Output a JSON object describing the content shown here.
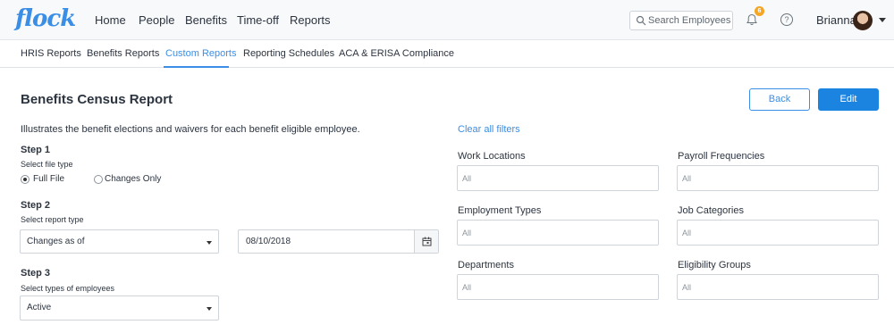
{
  "brand": {
    "logo_text": "flock",
    "accent": "#3a8ee6",
    "primary_button": "#1a84e0",
    "badge_color": "#f5a623"
  },
  "nav": {
    "items": [
      "Home",
      "People",
      "Benefits",
      "Time-off",
      "Reports"
    ]
  },
  "header": {
    "search_placeholder": "Search Employees",
    "notification_count": "6",
    "user_name": "Brianna",
    "icons": {
      "search": "search-icon",
      "bell": "bell-icon",
      "help": "help-icon",
      "menu": "chevron-down-icon"
    }
  },
  "subnav": {
    "tabs": [
      "HRIS Reports",
      "Benefits Reports",
      "Custom Reports",
      "Reporting Schedules",
      "ACA & ERISA Compliance"
    ],
    "active": "Custom Reports"
  },
  "report": {
    "title": "Benefits Census Report",
    "back_label": "Back",
    "edit_label": "Edit",
    "description": "Illustrates the benefit elections and waivers for each benefit eligible employee.",
    "clear_filters": "Clear all filters"
  },
  "steps": {
    "step1": {
      "title": "Step 1",
      "subtitle": "Select file type",
      "options": [
        "Full File",
        "Changes Only"
      ],
      "selected": "Full File"
    },
    "step2": {
      "title": "Step 2",
      "subtitle": "Select report type",
      "report_type": "Changes as of",
      "date": "08/10/2018"
    },
    "step3": {
      "title": "Step 3",
      "subtitle": "Select types of employees",
      "employee_type": "Active"
    }
  },
  "filters": {
    "work_locations": {
      "label": "Work Locations",
      "value": "All"
    },
    "payroll_frequencies": {
      "label": "Payroll Frequencies",
      "value": "All"
    },
    "employment_types": {
      "label": "Employment Types",
      "value": "All"
    },
    "job_categories": {
      "label": "Job Categories",
      "value": "All"
    },
    "departments": {
      "label": "Departments",
      "value": "All"
    },
    "eligibility_groups": {
      "label": "Eligibility Groups",
      "value": "All"
    }
  }
}
